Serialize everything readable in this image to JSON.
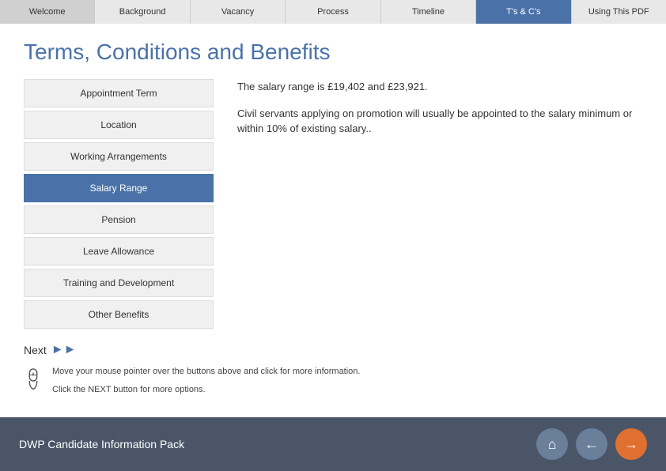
{
  "nav": {
    "items": [
      {
        "label": "Welcome",
        "active": false
      },
      {
        "label": "Background",
        "active": false
      },
      {
        "label": "Vacancy",
        "active": false
      },
      {
        "label": "Process",
        "active": false
      },
      {
        "label": "Timeline",
        "active": false
      },
      {
        "label": "T's & C's",
        "active": true
      },
      {
        "label": "Using This PDF",
        "active": false
      }
    ]
  },
  "page": {
    "title": "Terms, Conditions and Benefits"
  },
  "sidebar": {
    "items": [
      {
        "label": "Appointment Term",
        "active": false
      },
      {
        "label": "Location",
        "active": false
      },
      {
        "label": "Working Arrangements",
        "active": false
      },
      {
        "label": "Salary Range",
        "active": true
      },
      {
        "label": "Pension",
        "active": false
      },
      {
        "label": "Leave Allowance",
        "active": false
      },
      {
        "label": "Training and Development",
        "active": false
      },
      {
        "label": "Other Benefits",
        "active": false
      }
    ]
  },
  "content": {
    "salary_line1": "The salary range is £19,402  and £23,921.",
    "salary_line2": "Civil servants applying on promotion will usually be appointed to the salary minimum or within 10% of existing salary.."
  },
  "next_button": {
    "label": "Next",
    "arrows": "▶▶"
  },
  "info": {
    "line1": "Move your mouse pointer over the buttons above and click for more information.",
    "line2": "Click the NEXT button for more options."
  },
  "footer": {
    "title": "DWP Candidate Information Pack",
    "home_icon": "⌂",
    "back_icon": "←",
    "forward_icon": "→"
  }
}
